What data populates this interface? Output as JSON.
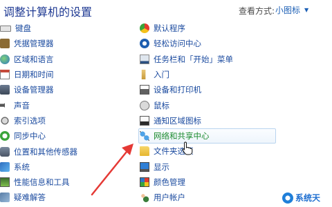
{
  "header": {
    "title": "调整计算机的设置",
    "view_label": "查看方式:",
    "view_value": "小图标"
  },
  "left_items": [
    {
      "label": "键盘",
      "icon": "keyboard-icon"
    },
    {
      "label": "凭据管理器",
      "icon": "credential-vault-icon"
    },
    {
      "label": "区域和语言",
      "icon": "globe-icon"
    },
    {
      "label": "日期和时间",
      "icon": "calendar-icon"
    },
    {
      "label": "设备管理器",
      "icon": "device-manager-icon"
    },
    {
      "label": "声音",
      "icon": "speaker-icon"
    },
    {
      "label": "索引选项",
      "icon": "index-icon"
    },
    {
      "label": "同步中心",
      "icon": "sync-icon"
    },
    {
      "label": "位置和其他传感器",
      "icon": "sensor-icon"
    },
    {
      "label": "系统",
      "icon": "system-icon"
    },
    {
      "label": "性能信息和工具",
      "icon": "performance-icon"
    },
    {
      "label": "疑难解答",
      "icon": "troubleshoot-icon"
    }
  ],
  "right_items": [
    {
      "label": "默认程序",
      "icon": "default-programs-icon"
    },
    {
      "label": "轻松访问中心",
      "icon": "ease-of-access-icon"
    },
    {
      "label": "任务栏和「开始」菜单",
      "icon": "taskbar-icon"
    },
    {
      "label": "入门",
      "icon": "getting-started-icon"
    },
    {
      "label": "设备和打印机",
      "icon": "printer-icon"
    },
    {
      "label": "鼠标",
      "icon": "mouse-icon"
    },
    {
      "label": "通知区域图标",
      "icon": "notification-area-icon"
    },
    {
      "label": "网络和共享中心",
      "icon": "network-icon"
    },
    {
      "label": "文件夹选项",
      "icon": "folder-icon"
    },
    {
      "label": "显示",
      "icon": "display-icon"
    },
    {
      "label": "颜色管理",
      "icon": "color-management-icon"
    },
    {
      "label": "用户帐户",
      "icon": "user-accounts-icon"
    }
  ],
  "watermark": {
    "text": "系统天"
  },
  "colors": {
    "title": "#1f3a93",
    "link": "#1a4a9f",
    "highlight_text": "#1c8b2e",
    "arrow": "#e53935"
  }
}
